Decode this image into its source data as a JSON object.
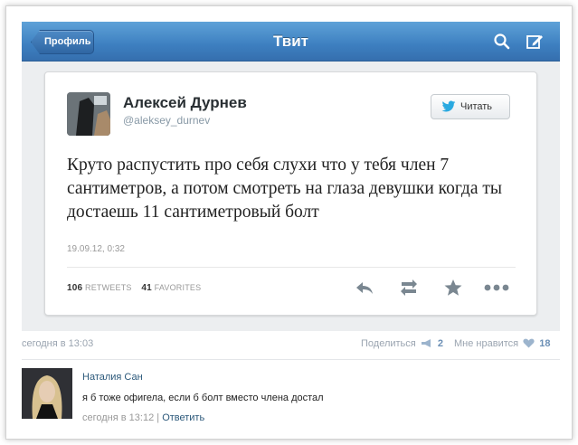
{
  "navbar": {
    "back_label": "Профиль",
    "title": "Твит",
    "search_icon": "search-icon",
    "compose_icon": "compose-icon"
  },
  "tweet": {
    "author_name": "Алексей Дурнев",
    "author_handle": "@aleksey_durnev",
    "follow_label": "Читать",
    "text": "Круто распустить про себя слухи что у тебя член 7 сантиметров, а потом смотреть на глаза девушки когда ты достаешь 11 сантиметровый болт",
    "date": "19.09.12, 0:32",
    "retweets_count": "106",
    "retweets_label": "RETWEETS",
    "favorites_count": "41",
    "favorites_label": "FAVORITES",
    "actions": [
      "reply-icon",
      "retweet-icon",
      "star-icon",
      "more-icon"
    ]
  },
  "post_meta": {
    "time": "сегодня в 13:03",
    "share_label": "Поделиться",
    "share_count": "2",
    "like_label": "Мне нравится",
    "like_count": "18"
  },
  "comment": {
    "author": "Наталия Сан",
    "text": "я б тоже офигела, если б болт вместо члена достал",
    "time": "сегодня в 13:12",
    "separator": "|",
    "reply_label": "Ответить"
  },
  "colors": {
    "navbar": "#3d7fc0",
    "link": "#2b587a",
    "twitter_blue": "#2aa9e0"
  }
}
